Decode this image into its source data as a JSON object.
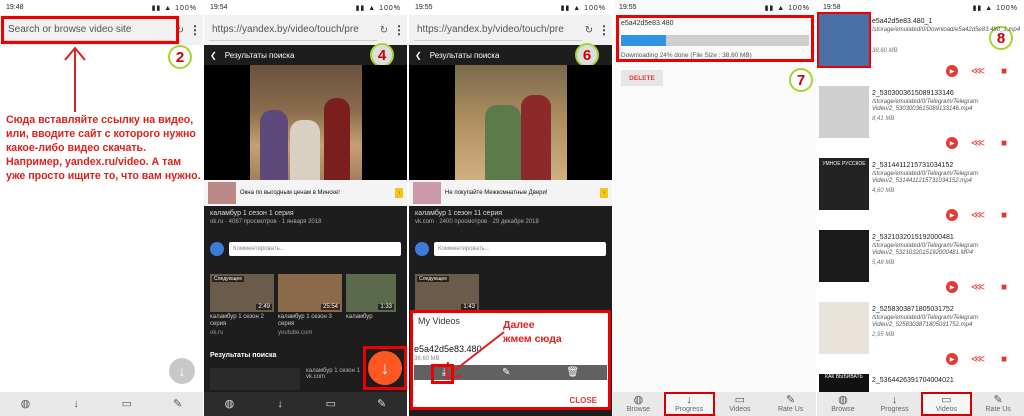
{
  "panel1": {
    "time": "19:48",
    "indicators": "▮▮ ▲ 100%",
    "url_placeholder": "Search or browse video site",
    "step": "2",
    "instructions": "Сюда вставляйте ссылку на видео, или, вводите сайт с которого нужно какое-либо видео скачать. Например, yandex.ru/video. А там уже просто ищите то, что вам нужно."
  },
  "panel2": {
    "time": "19:54",
    "indicators": "▮▮ ▲ 100%",
    "url": "https://yandex.by/video/touch/pre",
    "step": "4",
    "header": "Результаты поиска",
    "ad_text": "Окна по выгодным ценам в Минске!",
    "video_title": "каламбур 1 сезон 1 серия",
    "video_meta": "ok.ru · 4087 просмотров · 1 января 2018",
    "comment_placeholder": "Комментировать...",
    "thumbs": [
      {
        "tag": "Следующее",
        "dur": "2:49",
        "title": "каламбур 1 сезон 2 серия",
        "src": "ok.ru"
      },
      {
        "tag": "",
        "dur": "25:54",
        "title": "каламбур 1 сезон 3 серия",
        "src": "youtube.com"
      },
      {
        "tag": "",
        "dur": "1:33",
        "title": "каламбур",
        "src": ""
      }
    ],
    "results_title": "Результаты поиска",
    "result_item": "каламбур 1 сезон 1",
    "result_src": "vk.com"
  },
  "panel3": {
    "time": "19:55",
    "indicators": "▮▮ ▲ 100%",
    "url": "https://yandex.by/video/touch/pre",
    "step": "6",
    "header": "Результаты поиска",
    "ad_text": "Не покупайте Межкомнатные Двери!",
    "video_title": "каламбур 1 сезон 11 серия",
    "video_meta": "vk.com · 2400 просмотров · 29 декабря 2018",
    "comment_placeholder": "Комментировать...",
    "thumb": {
      "tag": "Следующее",
      "dur": "1:43"
    },
    "popup": {
      "title": "My Videos",
      "file_name": "e5a42d5e83.480",
      "file_size": "38,60 MB",
      "close_label": "CLOSE"
    },
    "annotation": "Далее жмем сюда"
  },
  "panel4": {
    "time": "19:55",
    "indicators": "▮▮ ▲ 100%",
    "file_name": "e5a42d5e83.480",
    "progress": 0.24,
    "status": "Downloading 24% done (File Size : 38,60 MB)",
    "delete_label": "DELETE",
    "step": "7"
  },
  "panel5": {
    "time": "19:58",
    "indicators": "▮▮ ▲ 100%",
    "step": "8",
    "videos": [
      {
        "name": "e5a42d5e83.480_1",
        "path": "/storage/emulated/0/Download/e5a42d5e83.480_1.mp4",
        "size": "38,60 MB"
      },
      {
        "name": "2_5303003615089133146",
        "path": "/storage/emulated/0/Telegram/Telegram Video/2_5303003615089133146.mp4",
        "size": "8,41 MB"
      },
      {
        "name": "2_5314411215731034152",
        "path": "/storage/emulated/0/Telegram/Telegram Video/2_5314411215731034152.mp4",
        "size": "4,60 MB"
      },
      {
        "name": "2_5321032015192000481",
        "path": "/storage/emulated/0/Telegram/Telegram Video/2_5321032015192000481.MP4",
        "size": "5,48 MB"
      },
      {
        "name": "2_5258303871805031752",
        "path": "/storage/emulated/0/Telegram/Telegram Video/2_5258303871805031752.mp4",
        "size": "2,95 MB"
      },
      {
        "name": "2_5364426391704004021",
        "path": "",
        "size": ""
      }
    ],
    "thumb_captions": [
      "УМНОЕ РУССКОЕ",
      "КАК ВЫБИВАТЬ"
    ]
  },
  "nav": {
    "browse": "Browse",
    "progress": "Progress",
    "videos": "Videos",
    "rate": "Rate Us"
  },
  "icons": {
    "browse": "globe-icon",
    "progress": "arrow-down-icon",
    "videos": "monitor-icon",
    "rate": "rate-icon"
  },
  "colors": {
    "accent_red": "#e53935",
    "annotation_red": "#e0201c",
    "progress_blue": "#2f95e3",
    "fab_orange": "#ff5722",
    "step_circle": "#a7d432"
  }
}
